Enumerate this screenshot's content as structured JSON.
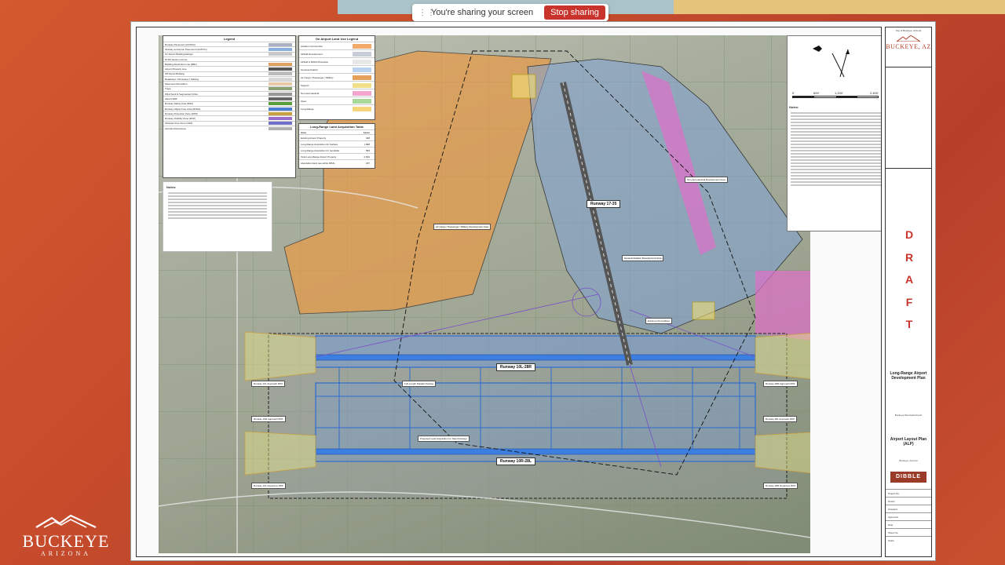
{
  "share_banner": {
    "message": "You're sharing your screen",
    "stop_label": "Stop sharing"
  },
  "brand": {
    "name": "BUCKEYE",
    "sub": "ARIZONA",
    "accent": "#c8342c"
  },
  "title_block": {
    "city": "City of Buckeye, Arizona",
    "logo": "BUCKEYE, AZ",
    "draft_letters": [
      "D",
      "R",
      "A",
      "F",
      "T"
    ],
    "title": "Long-Range Airport Development Plan",
    "airport": "Buckeye Municipal Airport",
    "sheet_title": "Airport Layout Plan (ALP)",
    "location": "Buckeye, Arizona",
    "firm": "DIBBLE",
    "rows": [
      {
        "label": "Project No.",
        "value": ""
      },
      {
        "label": "Drawn",
        "value": ""
      },
      {
        "label": "Checked",
        "value": ""
      },
      {
        "label": "Approved",
        "value": ""
      },
      {
        "label": "Date",
        "value": ""
      },
      {
        "label": "Sheet No.",
        "value": ""
      },
      {
        "label": "Scale",
        "value": ""
      }
    ]
  },
  "legend": {
    "title": "Legend",
    "rows": [
      "Runway Pavement (AC/PCC)",
      "Taxiway and Apron Pavement (AC/PCC)",
      "On Airport Building/Hangar",
      "PLSS Section Corner",
      "Building Restriction Line (BRL)",
      "Airport Property Line",
      "Off Airport Building",
      "Roadways / Driveways / Parking",
      "Pavement Demolition",
      "Trees",
      "Wind Sock & Segmented Circle",
      "Airport ARP",
      "Runway Safety Area (RSA)",
      "Runway Object Free Area (ROFA)",
      "Runway Protection Zone (RPZ)",
      "Runway Visibility Zone (RVZ)",
      "Obstacle Free Zone (OFZ)",
      "Aircraft Critical Area"
    ],
    "swatch_colors": [
      "#aab1c2",
      "#8ab0e0",
      "#c8c8c8",
      "#ffffff",
      "#e0a060",
      "#555555",
      "#bbbbbb",
      "#d9d9d9",
      "#e8c8a8",
      "#8aa070",
      "#999999",
      "#666666",
      "#5a9e3a",
      "#4a7fd0",
      "#c8a040",
      "#9a6cc8",
      "#7070c8",
      "#b0b0b0"
    ]
  },
  "on_airport_legend": {
    "title": "On Airport Land Use Legend",
    "rows": [
      "Aviation Commercial",
      "Airfield Development",
      "Airfield & ROFA Protection",
      "General Aviation",
      "Air Cargo / Passenger / Military",
      "Support",
      "Non-Aeronautical",
      "Open",
      "Long-Range"
    ],
    "colors": [
      "#f2a96a",
      "#c9cdd8",
      "#e8e8e8",
      "#b9d2ef",
      "#e6a05a",
      "#f0e08a",
      "#f4a6d0",
      "#a8d89a",
      "#f7d57a"
    ]
  },
  "land_table": {
    "title": "Long-Range Land Acquisition Table",
    "headers": [
      "Area",
      "Acres"
    ],
    "rows": [
      [
        "Existing Airport Property",
        "338"
      ],
      [
        "Long-Range Acquisition Air Surface",
        "1,898"
      ],
      [
        "Long-Range Acquisition for Landside",
        "583"
      ],
      [
        "Total Long-Range Airport Property",
        "2,819"
      ],
      [
        "Acquisition land use within RPZs",
        "187"
      ]
    ]
  },
  "notes": {
    "heading": "Notes:"
  },
  "scale": {
    "ticks": [
      "0'",
      "600'",
      "1,200'",
      "2,400'"
    ]
  },
  "map_labels": {
    "rwy_north": "Runway 10L-28R",
    "rwy_south": "Runway 10R-28L",
    "crosswind": "Runway 17-35",
    "west_dev": "Air Cargo / Passenger / Military Development Area",
    "east_dev": "General Aviation Development Area",
    "non_aero": "Non-Aeronautical Development Area",
    "terminal": "Existing GA Facilities",
    "full_taxiway": "Full-Length Parallel Taxiway",
    "land_acq": "Proposed Land Acquisition for New Runways",
    "rpz_labels": [
      "Runway 10L Approach RPZ",
      "Runway 10R Approach RPZ",
      "Runway 28R Approach RPZ",
      "Runway 28L Approach RPZ",
      "Runway 10L Departure RPZ",
      "Runway 28R Departure RPZ"
    ]
  }
}
